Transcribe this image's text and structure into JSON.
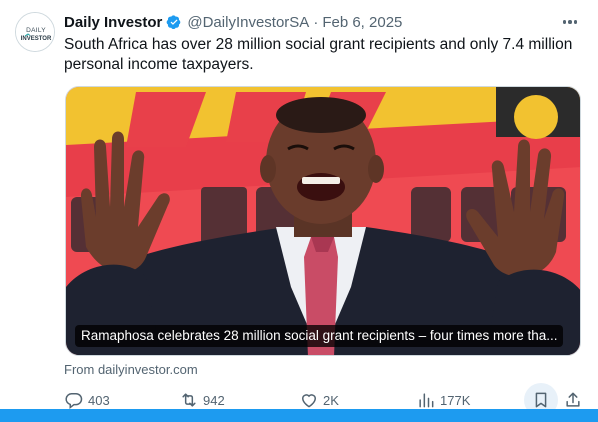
{
  "author": {
    "avatar_text_top": "DAILY",
    "avatar_text_bottom": "INVESTOR",
    "name": "Daily Investor",
    "handle": "@DailyInvestorSA",
    "separator": "·",
    "date": "Feb 6, 2025"
  },
  "tweet": {
    "text": "South Africa has over 28 million social grant recipients and only 7.4 million personal income taxpayers."
  },
  "media": {
    "caption": "Ramaphosa celebrates 28 million social grant recipients – four times more tha...",
    "source": "From dailyinvestor.com"
  },
  "actions": {
    "reply_count": "403",
    "repost_count": "942",
    "like_count": "2K",
    "view_count": "177K"
  },
  "icons": {
    "verified": "verified-badge-icon",
    "more": "more-dots-icon",
    "reply": "reply-icon",
    "repost": "repost-icon",
    "like": "heart-icon",
    "views": "views-chart-icon",
    "bookmark": "bookmark-icon",
    "share": "share-icon"
  },
  "colors": {
    "accent": "#1d9bf0",
    "text_primary": "#0f1419",
    "text_secondary": "#536471",
    "banner_red": "#e8404a",
    "banner_yellow": "#f2c230"
  }
}
